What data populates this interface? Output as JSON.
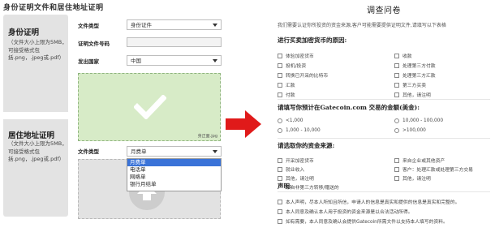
{
  "left": {
    "title": "身份证明文件和居住地址证明",
    "id_panel": {
      "heading": "身份证明",
      "note": [
        "（文件大小上限为5MB，",
        "可接受格式包",
        "括.png，.jpeg或.pdf）"
      ]
    },
    "address_panel": {
      "heading": "居住地址证明",
      "note": [
        "（文件大小上限为5MB，",
        "可接受格式包",
        "括.png，.jpeg或.pdf）"
      ]
    },
    "id_form": {
      "doc_type_label": "文件类型",
      "doc_type_value": "身份证件",
      "doc_number_label": "证明文件号码",
      "doc_number_value": "",
      "country_label": "发出国家",
      "country_value": "中国",
      "upload_caption": "身正面.jpg"
    },
    "address_form": {
      "doc_type_label": "文件类型",
      "doc_type_value": "月费单",
      "options": [
        "月费单",
        "电话单",
        "网络单",
        "银行月结单"
      ],
      "selected_option": "月费单"
    }
  },
  "arrow": {
    "color": "#e01a1a"
  },
  "survey": {
    "title": "调查问卷",
    "intro": "我们需要认证你所投资的资金来源,客户可能需要提供证明文件,请填写以下表格",
    "q1": {
      "title": "进行买卖加密货币的原因:",
      "options": [
        "体验加密货币",
        "投机/投资",
        "转换已开采的比特币",
        "汇款",
        "付款",
        "收款",
        "处理第三方付款",
        "处理第三方汇款",
        "第三方买卖",
        "其他，请注明"
      ]
    },
    "q2": {
      "title": "请填写你预计在Gatecoin.com 交易的金额(美金):",
      "options": [
        "<1,000",
        "1,000 - 10,000",
        "10,000 - 100,000",
        ">100,000"
      ]
    },
    "q3": {
      "title": "请选取你的资金来源:",
      "options": [
        "开采加密货币",
        "就业收入",
        "其他，请注明",
        "来自非第三方转移/赠送的",
        "来自企业或其他资产",
        "客户：处理汇款或处理第三方交易",
        "其他，请注明"
      ]
    },
    "q4": {
      "title": "声明:",
      "options": [
        "本人声明，尽本人所知且所信，申请人的信息是真实和提供的信息是真实和完整的。",
        "本人同意及确认本人用于投资的资金来源是以合法活动所得。",
        "如有需要，本人同意及确认会提供Gatecoin所需文件以支持本人填写的资料。"
      ]
    }
  }
}
